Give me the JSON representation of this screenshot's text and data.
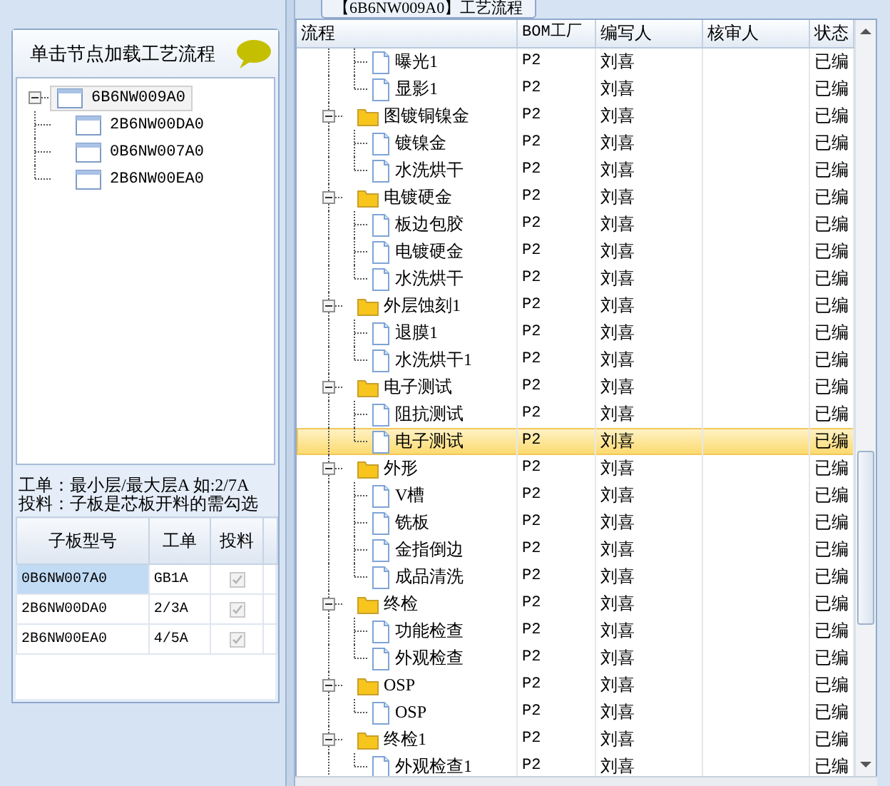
{
  "tab": {
    "label": "【6B6NW009A0】工艺流程"
  },
  "left": {
    "header": {
      "title": "单击节点加载工艺流程"
    },
    "tree": {
      "label": "6B6NW009A0",
      "selected": true,
      "expanded": true,
      "children": [
        {
          "label": "2B6NW00DA0",
          "selected": false
        },
        {
          "label": "0B6NW007A0",
          "selected": false
        },
        {
          "label": "2B6NW00EA0",
          "selected": false
        }
      ]
    },
    "notes": [
      "工单：最小层/最大层A 如:2/7A",
      "投料：子板是芯板开料的需勾选"
    ],
    "table": {
      "columns": [
        "子板型号",
        "工单",
        "投料"
      ],
      "rows": [
        {
          "model": "0B6NW007A0",
          "order": "GB1A",
          "feed": true,
          "disabled": true,
          "selected": true
        },
        {
          "model": "2B6NW00DA0",
          "order": "2/3A",
          "feed": true,
          "disabled": true,
          "selected": false
        },
        {
          "model": "2B6NW00EA0",
          "order": "4/5A",
          "feed": true,
          "disabled": true,
          "selected": false
        }
      ]
    }
  },
  "grid": {
    "columns": [
      "流程",
      "BOM工厂",
      "编写人",
      "核审人",
      "状态"
    ],
    "groups": [
      {
        "children": [
          {
            "label": "曝光1",
            "bom": "P2",
            "author": "刘喜",
            "status": "已编",
            "selected": false
          },
          {
            "label": "显影1",
            "bom": "P2",
            "author": "刘喜",
            "status": "已编",
            "selected": false
          }
        ]
      },
      {
        "label": "图镀铜镍金",
        "bom": "P2",
        "author": "刘喜",
        "status": "已编",
        "expanded": true,
        "selected": false,
        "children": [
          {
            "label": "镀镍金",
            "bom": "P2",
            "author": "刘喜",
            "status": "已编",
            "selected": false
          },
          {
            "label": "水洗烘干",
            "bom": "P2",
            "author": "刘喜",
            "status": "已编",
            "selected": false
          }
        ]
      },
      {
        "label": "电镀硬金",
        "bom": "P2",
        "author": "刘喜",
        "status": "已编",
        "expanded": true,
        "selected": false,
        "children": [
          {
            "label": "板边包胶",
            "bom": "P2",
            "author": "刘喜",
            "status": "已编",
            "selected": false
          },
          {
            "label": "电镀硬金",
            "bom": "P2",
            "author": "刘喜",
            "status": "已编",
            "selected": false
          },
          {
            "label": "水洗烘干",
            "bom": "P2",
            "author": "刘喜",
            "status": "已编",
            "selected": false
          }
        ]
      },
      {
        "label": "外层蚀刻1",
        "bom": "P2",
        "author": "刘喜",
        "status": "已编",
        "expanded": true,
        "selected": false,
        "children": [
          {
            "label": "退膜1",
            "bom": "P2",
            "author": "刘喜",
            "status": "已编",
            "selected": false
          },
          {
            "label": "水洗烘干1",
            "bom": "P2",
            "author": "刘喜",
            "status": "已编",
            "selected": false
          }
        ]
      },
      {
        "label": "电子测试",
        "bom": "P2",
        "author": "刘喜",
        "status": "已编",
        "expanded": true,
        "selected": false,
        "children": [
          {
            "label": "阻抗测试",
            "bom": "P2",
            "author": "刘喜",
            "status": "已编",
            "selected": false
          },
          {
            "label": "电子测试",
            "bom": "P2",
            "author": "刘喜",
            "status": "已编",
            "selected": true
          }
        ]
      },
      {
        "label": "外形",
        "bom": "P2",
        "author": "刘喜",
        "status": "已编",
        "expanded": true,
        "selected": false,
        "children": [
          {
            "label": "V槽",
            "bom": "P2",
            "author": "刘喜",
            "status": "已编",
            "selected": false
          },
          {
            "label": "铣板",
            "bom": "P2",
            "author": "刘喜",
            "status": "已编",
            "selected": false
          },
          {
            "label": "金指倒边",
            "bom": "P2",
            "author": "刘喜",
            "status": "已编",
            "selected": false
          },
          {
            "label": "成品清洗",
            "bom": "P2",
            "author": "刘喜",
            "status": "已编",
            "selected": false
          }
        ]
      },
      {
        "label": "终检",
        "bom": "P2",
        "author": "刘喜",
        "status": "已编",
        "expanded": true,
        "selected": false,
        "children": [
          {
            "label": "功能检查",
            "bom": "P2",
            "author": "刘喜",
            "status": "已编",
            "selected": false
          },
          {
            "label": "外观检查",
            "bom": "P2",
            "author": "刘喜",
            "status": "已编",
            "selected": false
          }
        ]
      },
      {
        "label": "OSP",
        "bom": "P2",
        "author": "刘喜",
        "status": "已编",
        "expanded": true,
        "selected": false,
        "children": [
          {
            "label": "OSP",
            "bom": "P2",
            "author": "刘喜",
            "status": "已编",
            "selected": false
          }
        ]
      },
      {
        "label": "终检1",
        "bom": "P2",
        "author": "刘喜",
        "status": "已编",
        "expanded": true,
        "selected": false,
        "children": [
          {
            "label": "外观检查1",
            "bom": "P2",
            "author": "刘喜",
            "status": "已编",
            "selected": false
          }
        ]
      }
    ]
  }
}
